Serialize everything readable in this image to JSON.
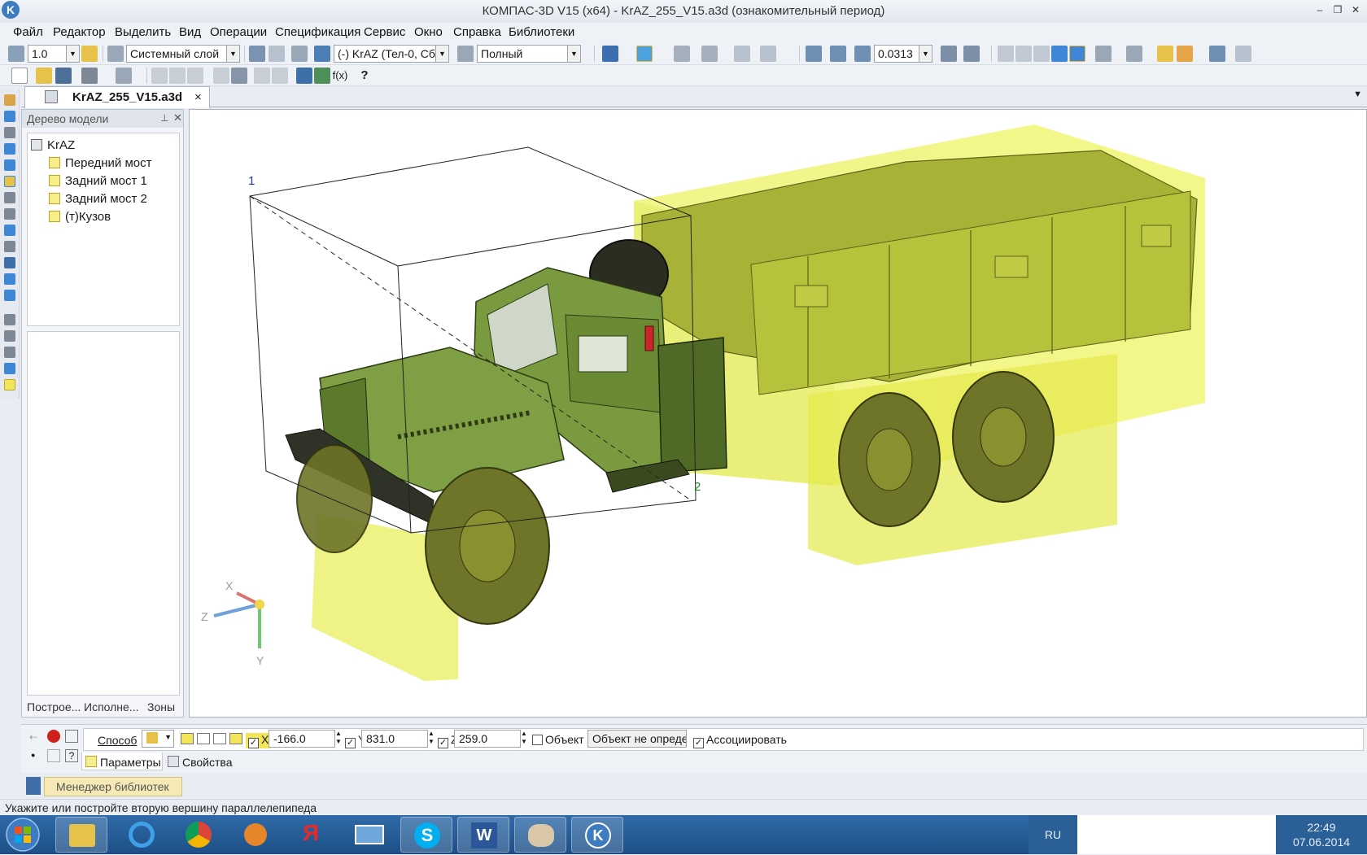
{
  "window": {
    "title": "КОМПАС-3D V15 (x64) - KrAZ_255_V15.a3d (ознакомительный период)",
    "logo": "K"
  },
  "menu": [
    "Файл",
    "Редактор",
    "Выделить",
    "Вид",
    "Операции",
    "Спецификация",
    "Сервис",
    "Окно",
    "Справка",
    "Библиотеки"
  ],
  "toolbar": {
    "step_value": "1.0",
    "layer": "Системный слой",
    "component": "(-) KrAZ (Тел-0, Сб",
    "render_mode": "Полный",
    "zoom": "0.0313"
  },
  "document_tab": {
    "label": "KrAZ_255_V15.a3d",
    "close": "×"
  },
  "model_tree": {
    "title": "Дерево модели",
    "root": "KrAZ",
    "items": [
      "Передний мост",
      "Задний мост 1",
      "Задний мост 2",
      "(т)Кузов"
    ],
    "tabs": [
      "Построе...",
      "Исполне...",
      "Зоны"
    ]
  },
  "viewport": {
    "vertex1_label": "1",
    "vertex2_label": "2",
    "axis_x": "X",
    "axis_y": "Y",
    "axis_z": "Z",
    "colors": {
      "highlight": "#e8ef5a",
      "truck": "#7a9a3f",
      "tarp": "#a7b236"
    }
  },
  "properties": {
    "method_label": "Способ",
    "x_label": "X",
    "x_value": "-166.0",
    "y_label": "Y",
    "y_value": "831.0",
    "z_label": "Z",
    "z_value": "259.0",
    "object_label": "Объект",
    "object_value": "Объект не определ",
    "associate_label": "Ассоциировать",
    "tab_params": "Параметры",
    "tab_props": "Свойства"
  },
  "library_manager": "Менеджер библиотек",
  "status": "Укажите или постройте вторую вершину параллелепипеда",
  "taskbar": {
    "lang": "RU",
    "time": "22:49",
    "date": "07.06.2014"
  }
}
